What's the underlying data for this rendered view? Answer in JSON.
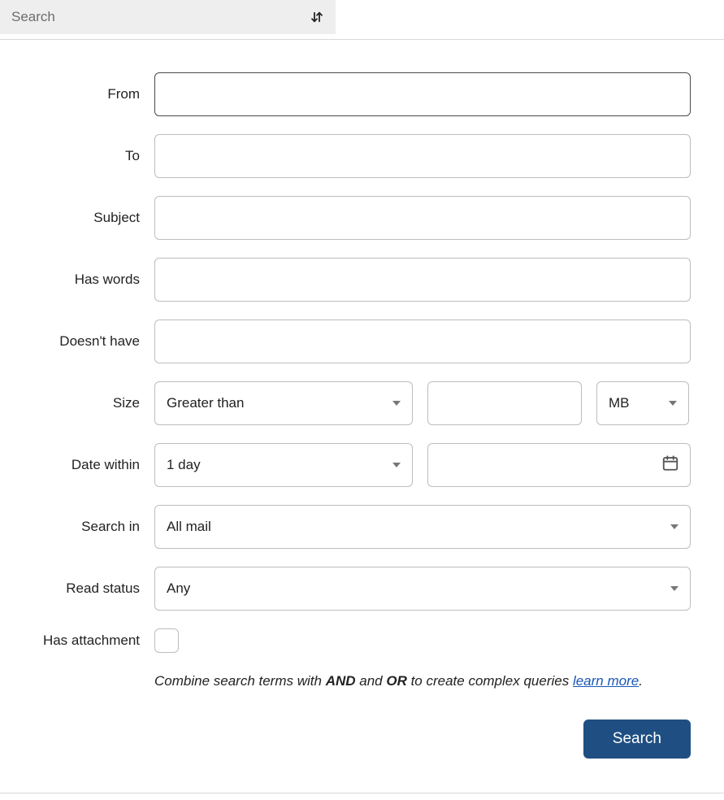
{
  "header": {
    "search_placeholder": "Search"
  },
  "form": {
    "from": {
      "label": "From",
      "value": ""
    },
    "to": {
      "label": "To",
      "value": ""
    },
    "subject": {
      "label": "Subject",
      "value": ""
    },
    "has_words": {
      "label": "Has words",
      "value": ""
    },
    "doesnt_have": {
      "label": "Doesn't have",
      "value": ""
    },
    "size": {
      "label": "Size",
      "comparator": "Greater than",
      "value": "",
      "unit": "MB"
    },
    "date": {
      "label": "Date within",
      "range": "1 day",
      "value": ""
    },
    "search_in": {
      "label": "Search in",
      "value": "All mail"
    },
    "read_status": {
      "label": "Read status",
      "value": "Any"
    },
    "has_attachment": {
      "label": "Has attachment",
      "checked": false
    }
  },
  "hint": {
    "prefix": "Combine search terms with ",
    "op1": "AND",
    "mid": " and ",
    "op2": "OR",
    "suffix": " to create complex queries ",
    "link": "learn more",
    "period": "."
  },
  "buttons": {
    "search": "Search"
  }
}
